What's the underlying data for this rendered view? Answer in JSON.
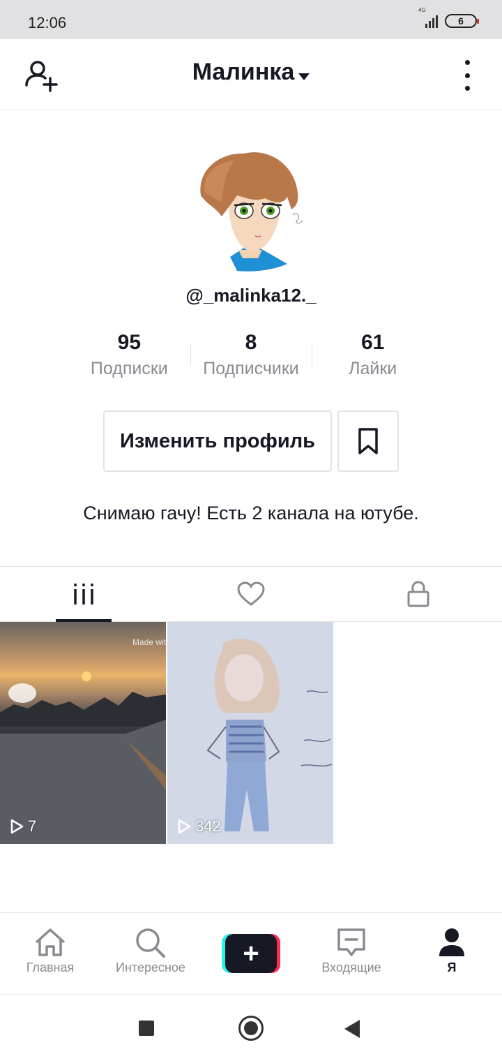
{
  "status_bar": {
    "time": "12:06",
    "network": "4G",
    "battery": "6"
  },
  "header": {
    "title": "Малинка"
  },
  "profile": {
    "username": "@_malinka12._",
    "stats": [
      {
        "value": "95",
        "label": "Подписки"
      },
      {
        "value": "8",
        "label": "Подписчики"
      },
      {
        "value": "61",
        "label": "Лайки"
      }
    ],
    "edit_button": "Изменить профиль",
    "bio": "Снимаю гачу! Есть 2 канала на ютубе."
  },
  "tabs": [
    {
      "icon": "grid-icon",
      "active": true
    },
    {
      "icon": "heart-icon",
      "active": false
    },
    {
      "icon": "lock-icon",
      "active": false
    }
  ],
  "videos": [
    {
      "views": "7",
      "watermark": "Made wit"
    },
    {
      "views": "342"
    }
  ],
  "bottom_nav": {
    "items": [
      {
        "label": "Главная",
        "icon": "home-icon"
      },
      {
        "label": "Интересное",
        "icon": "search-icon"
      },
      {
        "label": "",
        "icon": "plus-icon"
      },
      {
        "label": "Входящие",
        "icon": "inbox-icon"
      },
      {
        "label": "Я",
        "icon": "profile-icon",
        "active": true
      }
    ]
  },
  "colors": {
    "accent_cyan": "#25f4ee",
    "accent_red": "#fe2c55",
    "text": "#161823",
    "muted": "#8a8b91"
  }
}
